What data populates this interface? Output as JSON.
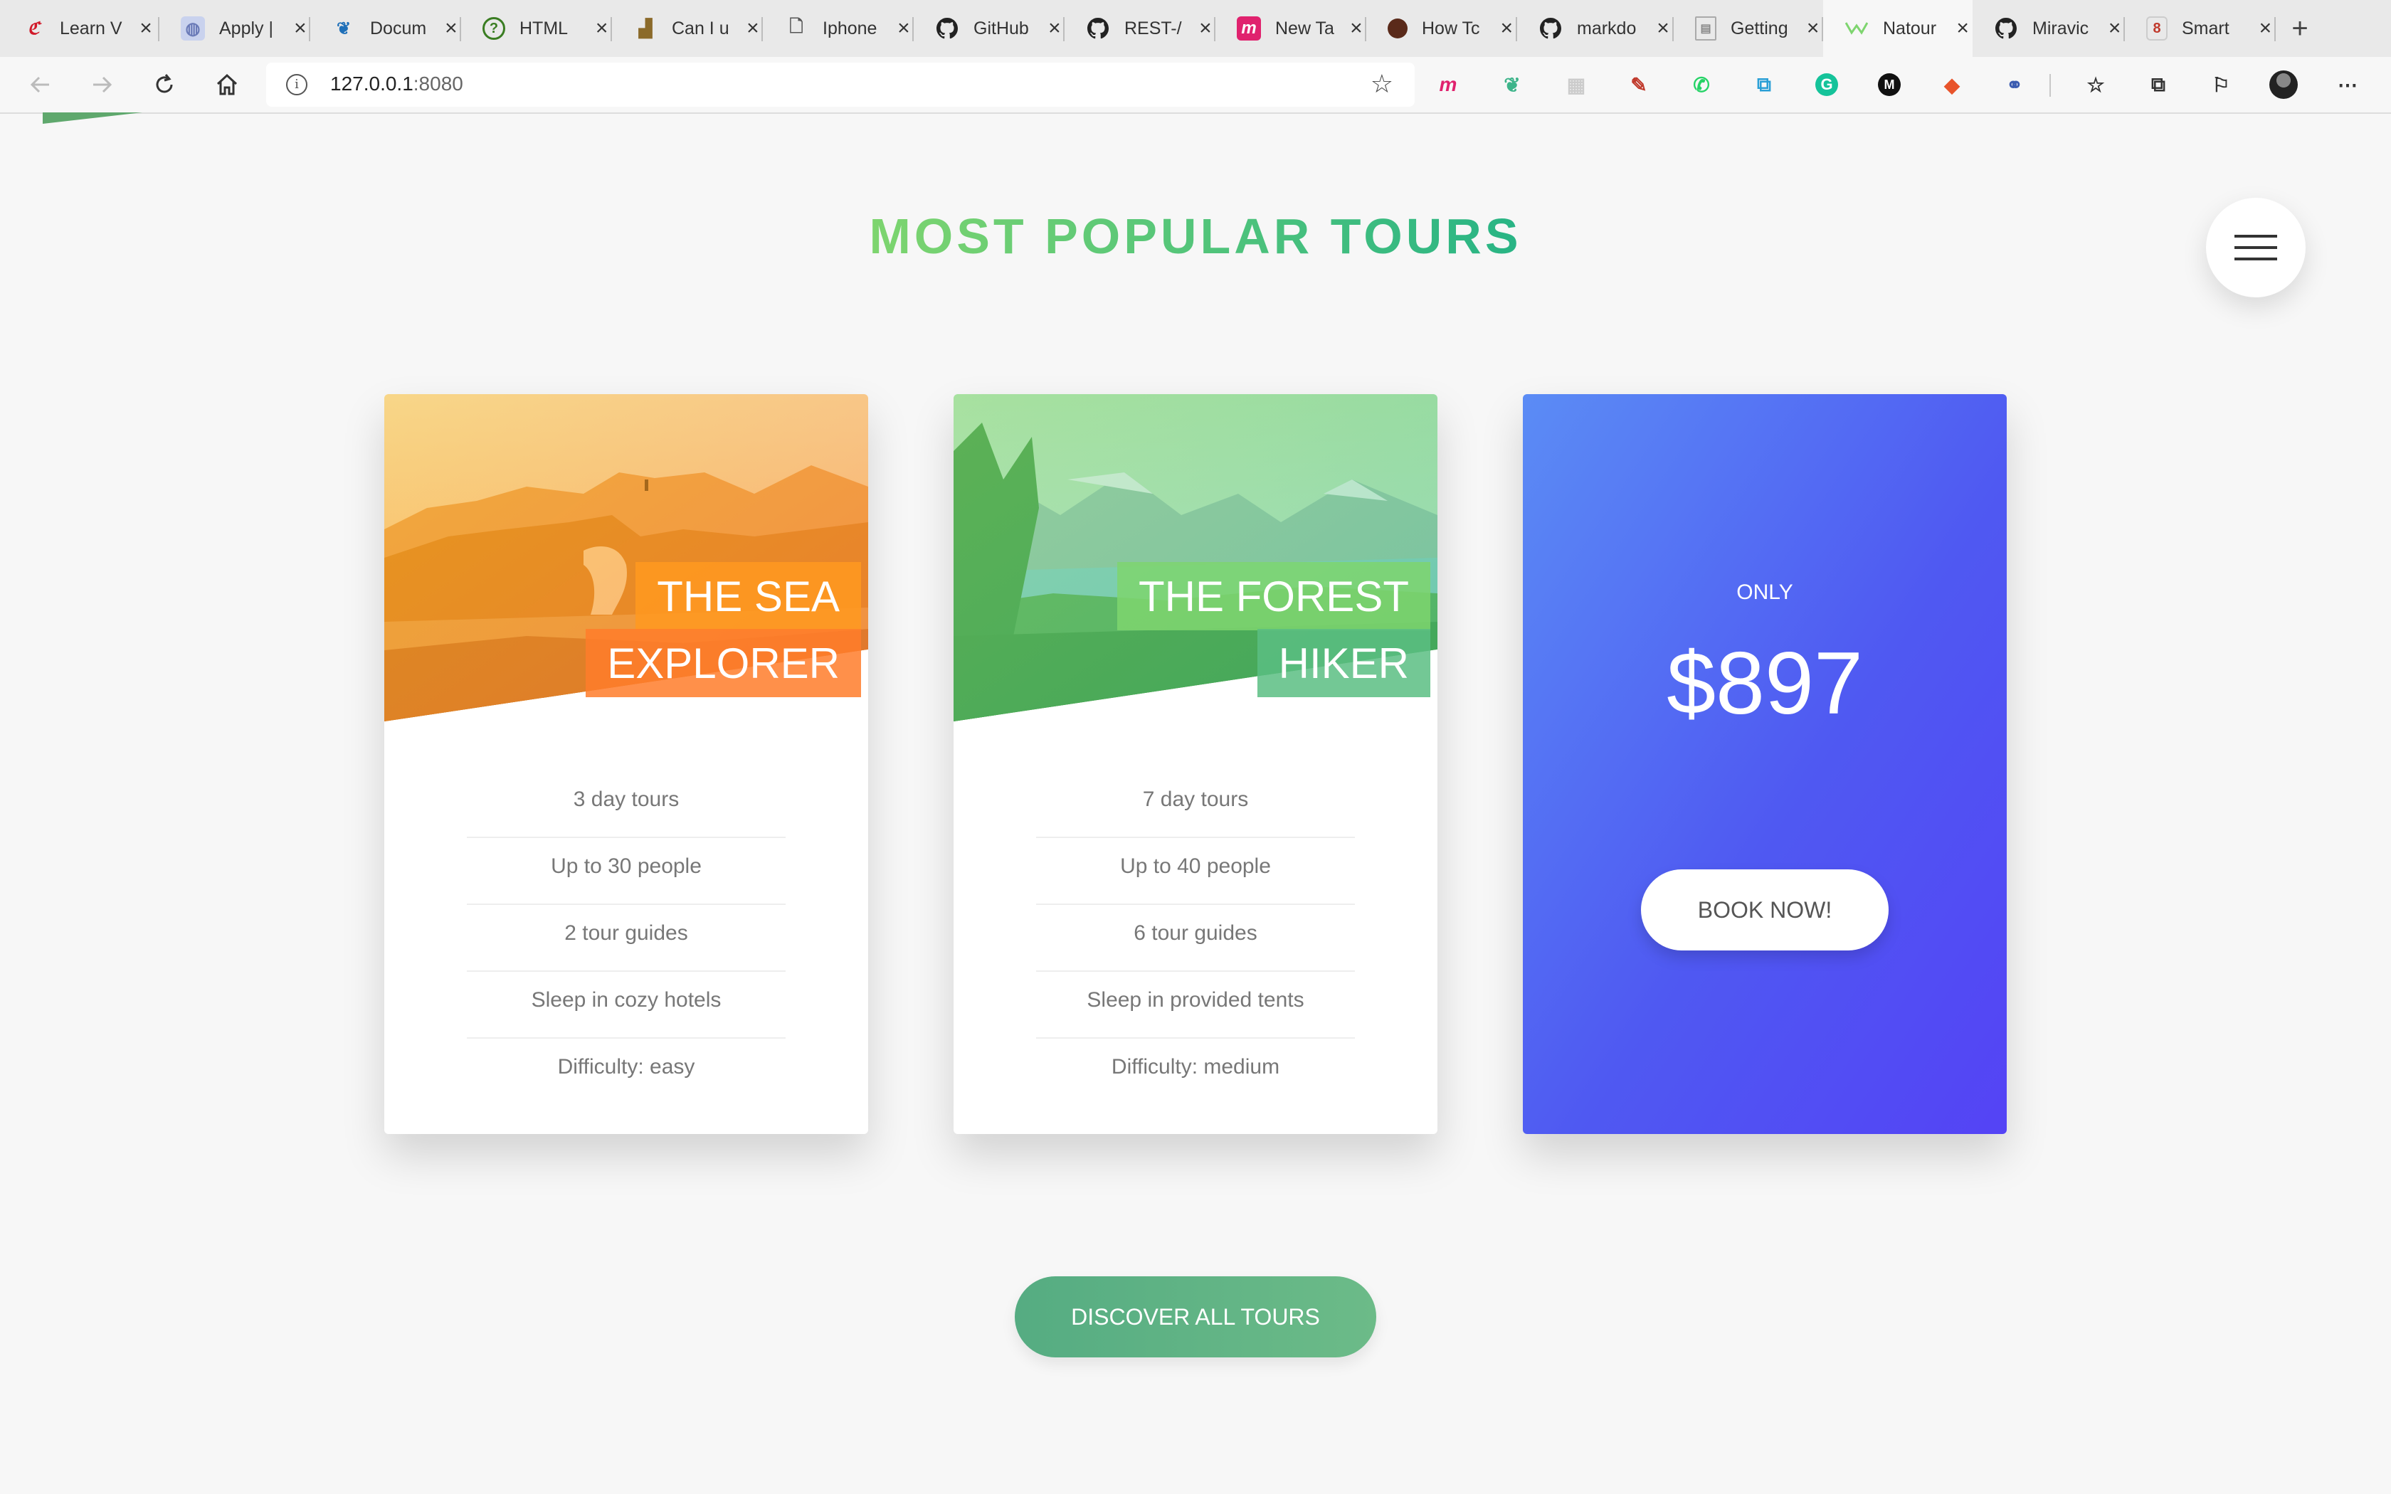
{
  "browser": {
    "tabs": [
      {
        "title": "Learn V",
        "favicon": "red-script-icon",
        "color": "#d11a2a"
      },
      {
        "title": "Apply |",
        "favicon": "globe-icon",
        "color": "#6b7bb8"
      },
      {
        "title": "Docum",
        "favicon": "bird-icon",
        "color": "#1e6fb8"
      },
      {
        "title": "HTML",
        "favicon": "question-circle-icon",
        "color": "#3a7d22"
      },
      {
        "title": "Can I u",
        "favicon": "chart-icon",
        "color": "#8b6a2a"
      },
      {
        "title": "Iphone",
        "favicon": "document-icon",
        "color": "#555555"
      },
      {
        "title": "GitHub",
        "favicon": "github-icon",
        "color": "#222222"
      },
      {
        "title": "REST-/",
        "favicon": "github-icon",
        "color": "#222222"
      },
      {
        "title": "New Ta",
        "favicon": "m-logo-icon",
        "color": "#e0226e"
      },
      {
        "title": "How Tc",
        "favicon": "avatar-icon",
        "color": "#5a2a1a"
      },
      {
        "title": "markdo",
        "favicon": "github-icon",
        "color": "#222222"
      },
      {
        "title": "Getting",
        "favicon": "page-icon",
        "color": "#888888"
      },
      {
        "title": "Natour",
        "favicon": "natours-icon",
        "color": "#7ed56f",
        "active": true
      },
      {
        "title": "Miravic",
        "favicon": "github-icon",
        "color": "#222222"
      },
      {
        "title": "Smart",
        "favicon": "smart-icon",
        "color": "#c0392b"
      }
    ],
    "close_glyph": "×",
    "new_tab_glyph": "+",
    "url_host": "127.0.0.1",
    "url_port": ":8080"
  },
  "page": {
    "heading": "MOST POPULAR TOURS",
    "cards": [
      {
        "title_lines": [
          "THE SEA",
          "EXPLORER"
        ],
        "details": [
          "3 day tours",
          "Up to 30 people",
          "2 tour guides",
          "Sleep in cozy hotels",
          "Difficulty: easy"
        ]
      },
      {
        "title_lines": [
          "THE FOREST",
          "HIKER"
        ],
        "details": [
          "7 day tours",
          "Up to 40 people",
          "6 tour guides",
          "Sleep in provided tents",
          "Difficulty: medium"
        ]
      }
    ],
    "price_card": {
      "only_label": "ONLY",
      "price": "$897",
      "button_label": "BOOK NOW!"
    },
    "discover_label": "DISCOVER ALL TOURS"
  },
  "colors": {
    "primary_light": "#7ed56f",
    "primary_dark": "#28b485",
    "secondary_light": "#ffb900",
    "secondary_dark": "#ff7730",
    "tertiary_light": "#5b8cf5",
    "tertiary_dark": "#5443f5"
  }
}
